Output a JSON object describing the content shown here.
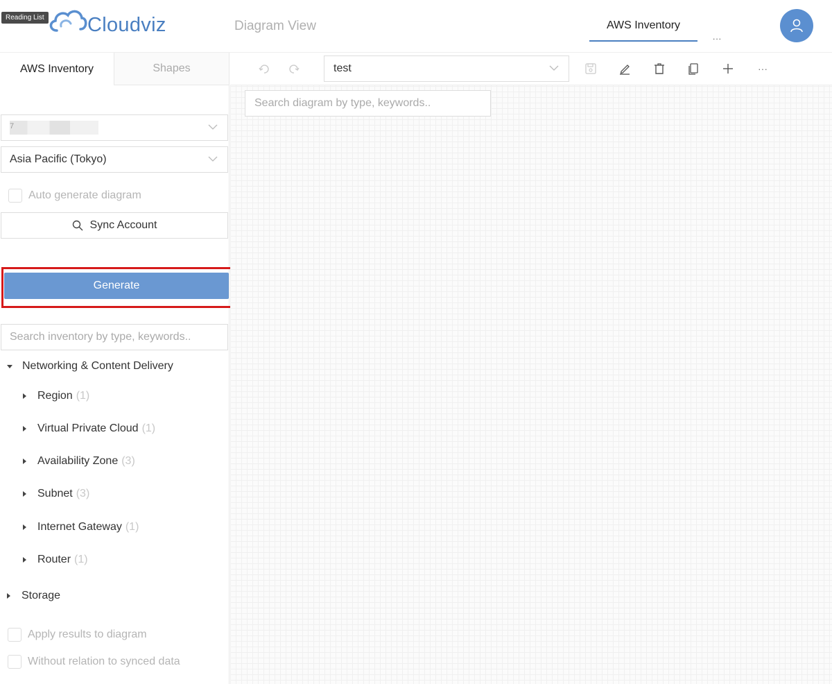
{
  "header": {
    "reading_list": "Reading List",
    "logo_text": "Cloudviz",
    "nav_diagram": "Diagram View",
    "nav_aws": "AWS Inventory",
    "nav_more": "...",
    "accent_color": "#4a7fc1"
  },
  "sidebar": {
    "tabs": [
      {
        "label": "AWS Inventory",
        "active": true
      },
      {
        "label": "Shapes",
        "active": false
      }
    ],
    "account_select": {
      "value": "7",
      "redacted": true
    },
    "region_select": {
      "value": "Asia Pacific (Tokyo)"
    },
    "auto_generate": {
      "label": "Auto generate diagram",
      "checked": false
    },
    "sync_button": {
      "label": "Sync Account",
      "icon": "search-icon"
    },
    "generate_button": {
      "label": "Generate",
      "highlighted": true,
      "color": "#6a98d2"
    },
    "search_inventory": {
      "placeholder": "Search inventory by type, keywords.."
    },
    "tree": {
      "networking": {
        "label": "Networking & Content Delivery",
        "expanded": true,
        "items": [
          {
            "label": "Region",
            "count": "(1)"
          },
          {
            "label": "Virtual Private Cloud",
            "count": "(1)"
          },
          {
            "label": "Availability Zone",
            "count": "(3)"
          },
          {
            "label": "Subnet",
            "count": "(3)"
          },
          {
            "label": "Internet Gateway",
            "count": "(1)"
          },
          {
            "label": "Router",
            "count": "(1)"
          }
        ]
      },
      "storage": {
        "label": "Storage",
        "expanded": false
      }
    },
    "apply_results": {
      "label": "Apply results to diagram",
      "checked": false
    },
    "without_relation": {
      "label": "Without relation to synced data",
      "checked": false
    }
  },
  "main": {
    "toolbar": {
      "diagram_select": {
        "value": "test"
      },
      "icons": [
        "undo-icon",
        "redo-icon",
        "save-icon",
        "edit-icon",
        "delete-icon",
        "copy-icon",
        "add-icon",
        "more-icon"
      ],
      "more_label": "···"
    },
    "search_diagram": {
      "placeholder": "Search diagram by type, keywords.."
    }
  }
}
